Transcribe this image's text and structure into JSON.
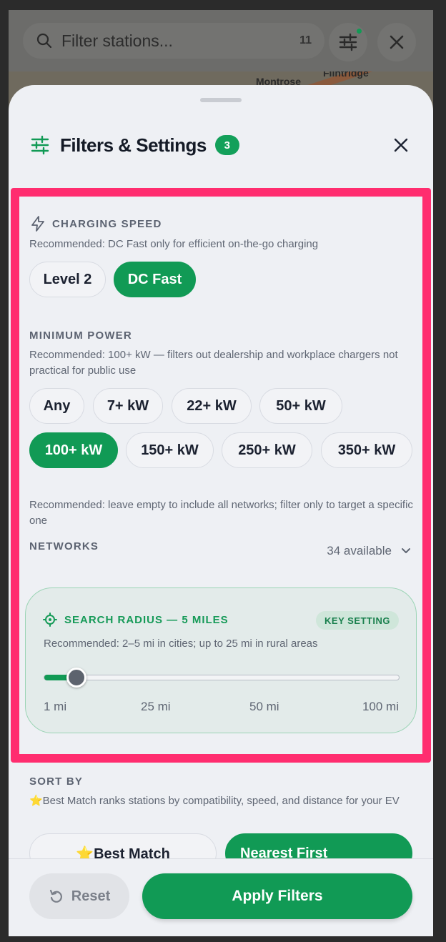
{
  "search": {
    "placeholder": "Filter stations...",
    "count": "11"
  },
  "map": {
    "labels": [
      "Montrose",
      "Flintridge"
    ]
  },
  "sheet": {
    "title": "Filters & Settings",
    "badge": "3"
  },
  "charging_speed": {
    "title": "CHARGING SPEED",
    "hint": "Recommended: DC Fast only for efficient on-the-go charging",
    "options": [
      "Level 2",
      "DC Fast"
    ],
    "selected": "DC Fast"
  },
  "minimum_power": {
    "title": "MINIMUM POWER",
    "hint": "Recommended: 100+ kW — filters out dealership and workplace chargers not practical for public use",
    "options": [
      "Any",
      "7+ kW",
      "22+ kW",
      "50+ kW",
      "100+ kW",
      "150+ kW",
      "250+ kW",
      "350+ kW"
    ],
    "selected": "100+ kW"
  },
  "networks": {
    "hint": "Recommended: leave empty to include all networks; filter only to target a specific one",
    "title": "NETWORKS",
    "available": "34 available"
  },
  "search_radius": {
    "title": "SEARCH RADIUS — 5 MILES",
    "badge": "KEY SETTING",
    "hint": "Recommended: 2–5 mi in cities; up to 25 mi in rural areas",
    "ticks": [
      "1 mi",
      "25 mi",
      "50 mi",
      "100 mi"
    ],
    "value_miles": 5,
    "min_miles": 1,
    "max_miles": 100
  },
  "sort_by": {
    "title": "SORT BY",
    "hint": "⭐Best Match ranks stations by compatibility, speed, and distance for your EV",
    "options": [
      "⭐Best Match",
      "Nearest First"
    ],
    "selected": "Nearest First"
  },
  "footer": {
    "reset": "Reset",
    "apply": "Apply Filters"
  },
  "colors": {
    "accent": "#119a55",
    "highlight": "#ff2d6f"
  }
}
